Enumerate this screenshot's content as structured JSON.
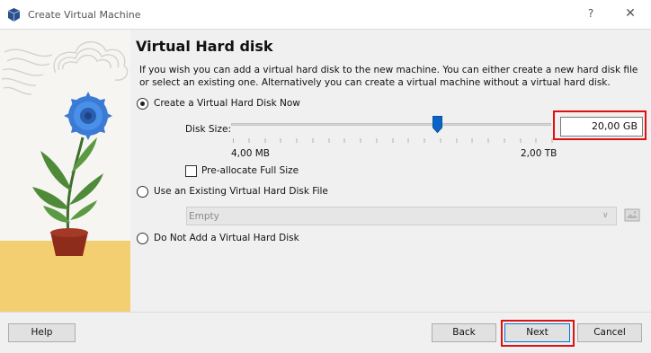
{
  "window": {
    "title": "Create Virtual Machine",
    "help_glyph": "?",
    "close_glyph": "✕"
  },
  "page": {
    "heading": "Virtual Hard disk",
    "description": "If you wish you can add a virtual hard disk to the new machine. You can either create a new hard disk file or select an existing one. Alternatively you can create a virtual machine without a virtual hard disk."
  },
  "options": {
    "create_now": {
      "label": "Create a Virtual Hard Disk Now",
      "checked": true
    },
    "use_existing": {
      "label": "Use an Existing Virtual Hard Disk File",
      "checked": false
    },
    "do_not_add": {
      "label": "Do Not Add a Virtual Hard Disk",
      "checked": false
    }
  },
  "disk_size": {
    "label": "Disk Size:",
    "value": "20,00 GB",
    "min_label": "4,00 MB",
    "max_label": "2,00 TB"
  },
  "preallocate": {
    "label": "Pre-allocate Full Size",
    "checked": false
  },
  "existing_file": {
    "selected": "Empty",
    "arrow_glyph": "∨"
  },
  "footer": {
    "help_label": "Help",
    "back_label": "Back",
    "next_label": "Next",
    "cancel_label": "Cancel"
  },
  "colors": {
    "highlight_box": "#e01010",
    "slider_thumb": "#0a64c8",
    "flower": "#3a7bd5"
  }
}
